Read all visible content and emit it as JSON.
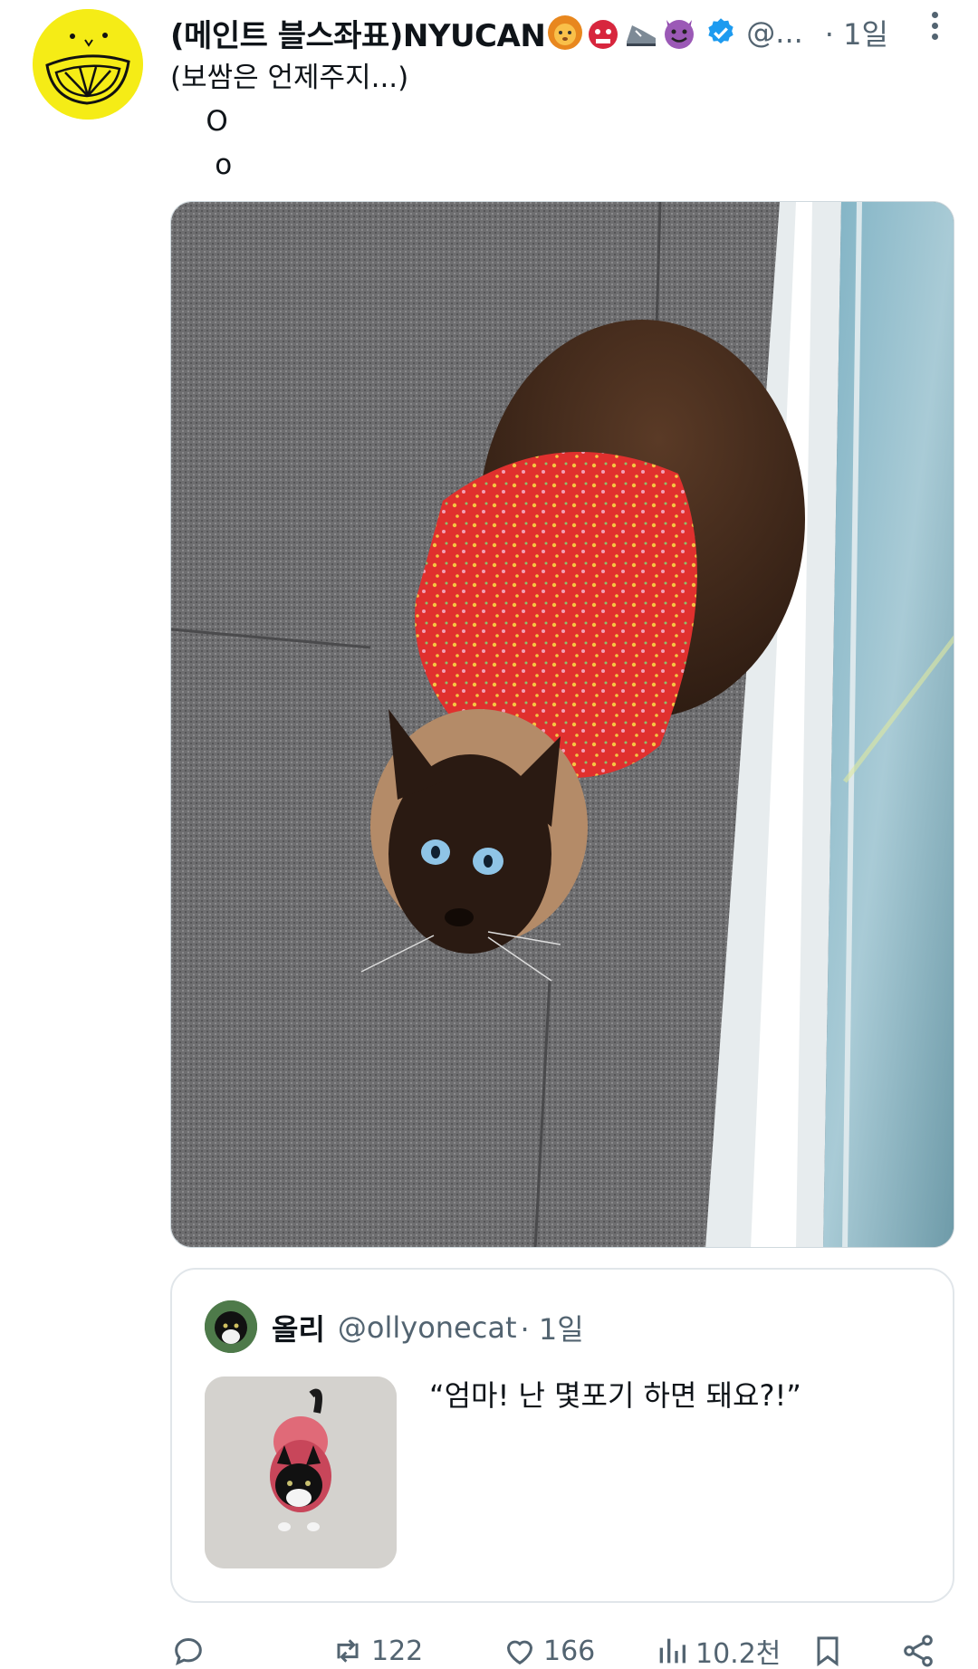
{
  "tweet": {
    "display_name": "(메인트 블스좌표)NYUCAN",
    "emojis": [
      "lion-face-icon",
      "ogre-icon",
      "running-shoe-icon",
      "smiling-devil-icon"
    ],
    "verified_icon": "verified-badge-icon",
    "handle": "@...",
    "time": "· 1일",
    "text_lines": [
      "(보쌈은 언제주지...)",
      "    O",
      "     o"
    ]
  },
  "quote": {
    "name": "올리",
    "handle": "@ollyonecat",
    "time": "· 1일",
    "text": "“엄마! 난 몇포기 하면 돼요?!”"
  },
  "actions": {
    "reply_icon": "reply-bubble-icon",
    "retweet_icon": "retweet-icon",
    "retweet_count": "122",
    "like_icon": "heart-icon",
    "like_count": "166",
    "views_icon": "bar-chart-icon",
    "views_count": "10.2천",
    "bookmark_icon": "bookmark-icon",
    "share_icon": "share-icon"
  },
  "colors": {
    "accent": "#1d9bf0",
    "muted": "#536471",
    "text": "#0f1419",
    "avatar_bg": "#f5ec16"
  }
}
